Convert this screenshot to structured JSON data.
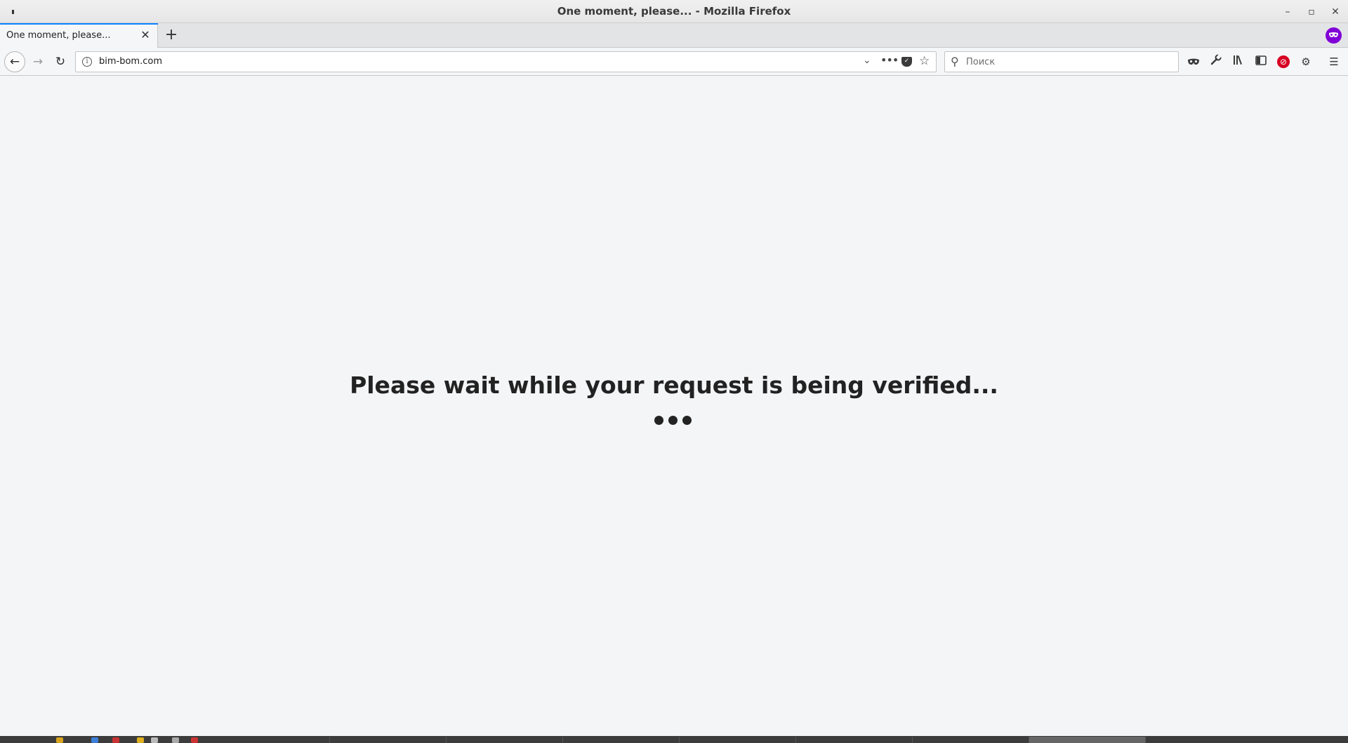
{
  "window": {
    "title": "One moment, please... - Mozilla Firefox",
    "minimize_glyph": "–",
    "maximize_glyph": "▫",
    "close_glyph": "✕"
  },
  "tabs": [
    {
      "label": "One moment, please...",
      "close_glyph": "✕",
      "active": true
    }
  ],
  "newtab_glyph": "+",
  "extension_icon": "mask-icon",
  "nav": {
    "back_glyph": "←",
    "forward_glyph": "→",
    "reload_glyph": "↻"
  },
  "urlbar": {
    "url": "bim-bom.com",
    "info_glyph": "i",
    "dropdown_glyph": "⌄",
    "more_glyph": "•••",
    "star_glyph": "☆"
  },
  "search": {
    "placeholder": "Поиск",
    "value": ""
  },
  "toolbar_icons": [
    "mask-icon",
    "wrench-icon",
    "library-icon",
    "sidebar-icon",
    "blocked-icon",
    "gear-icon",
    "hamburger-menu-icon"
  ],
  "page": {
    "heading": "Please wait while your request is being verified..."
  },
  "colors": {
    "accent": "#0a84ff",
    "extension": "#8000d7",
    "blocked": "#d70022",
    "page_bg": "#f4f5f7"
  }
}
